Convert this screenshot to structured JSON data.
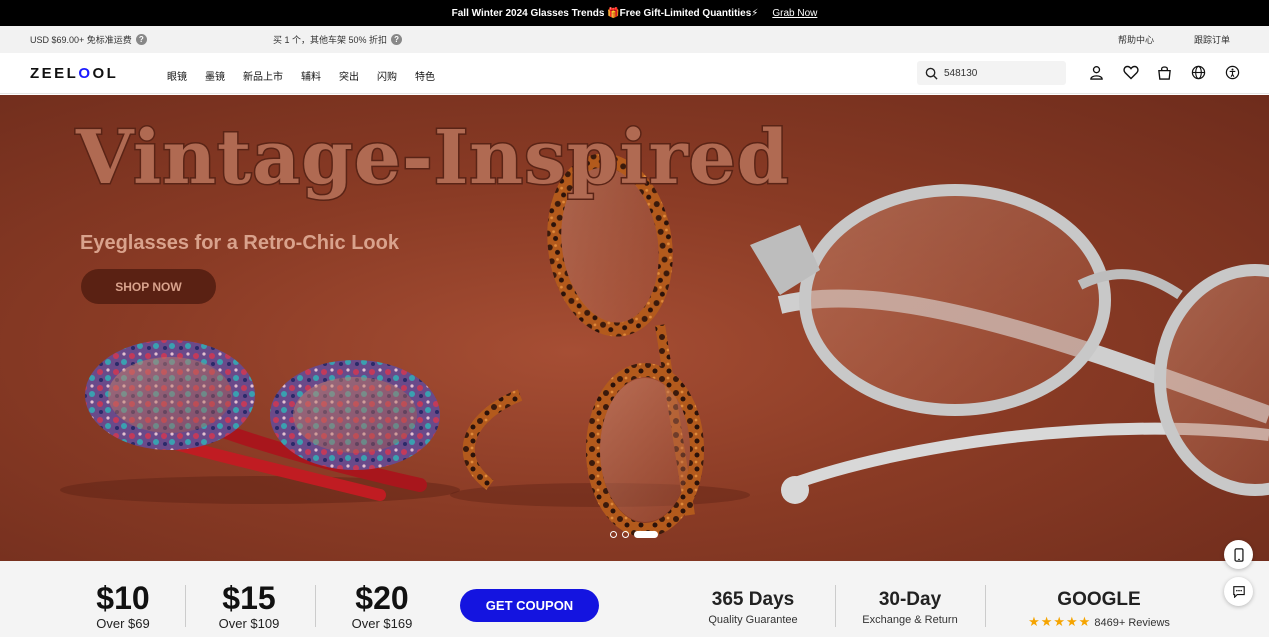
{
  "announcement": {
    "text": "Fall Winter 2024 Glasses Trends 🎁Free Gift-Limited Quantities⚡",
    "link": "Grab Now"
  },
  "utility": {
    "shipping": "USD $69.00+ 免标准运费",
    "promo": "买 1 个，其他车架 50% 折扣",
    "help": "帮助中心",
    "track": "跟踪订单"
  },
  "header": {
    "logo": "ZEELOOL",
    "nav": [
      "眼镜",
      "墨镜",
      "新品上市",
      "辅料",
      "突出",
      "闪购",
      "特色"
    ],
    "search_value": "548130",
    "icons": [
      "user-icon",
      "heart-icon",
      "bag-icon",
      "globe-icon",
      "accessibility-icon"
    ]
  },
  "hero": {
    "title": "Vintage-Inspired",
    "subtitle": "Eyeglasses for a Retro-Chic Look",
    "button": "SHOP NOW",
    "slides": 3,
    "active_slide": 3
  },
  "strip": {
    "coupons": [
      {
        "amount": "$10",
        "over": "Over $69"
      },
      {
        "amount": "$15",
        "over": "Over $109"
      },
      {
        "amount": "$20",
        "over": "Over $169"
      }
    ],
    "coupon_button": "GET COUPON",
    "features": [
      {
        "big": "365 Days",
        "small": "Quality Guarantee"
      },
      {
        "big": "30-Day",
        "small": "Exchange & Return"
      },
      {
        "big": "GOOGLE",
        "small": "8469+ Reviews",
        "stars": "★★★★★"
      }
    ]
  },
  "colors": {
    "accent": "#1414e0",
    "hero_bg": "#8a3b25",
    "topbar": "#000000"
  }
}
